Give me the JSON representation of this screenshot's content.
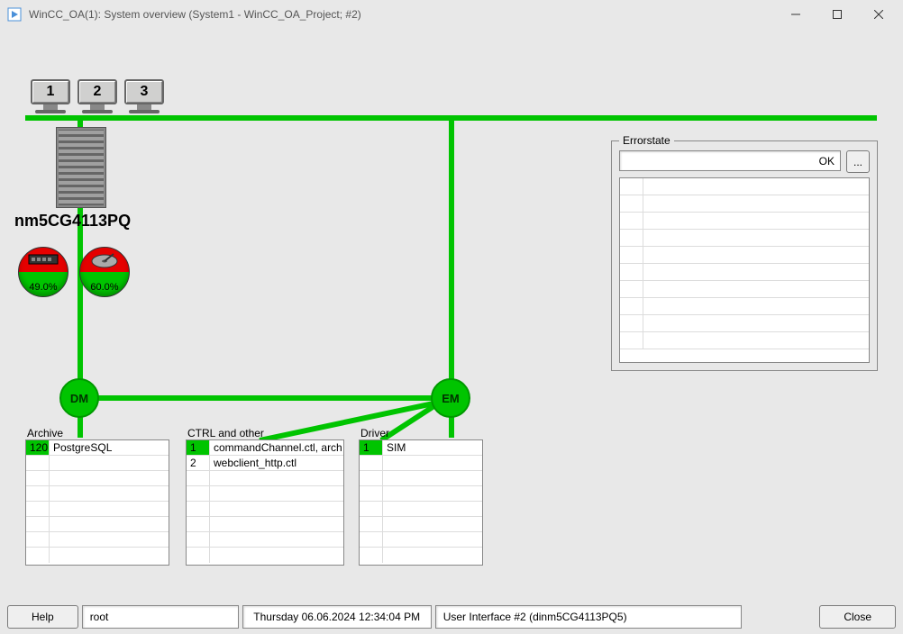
{
  "window": {
    "title": "WinCC_OA(1): System overview (System1 - WinCC_OA_Project; #2)"
  },
  "monitors": [
    "1",
    "2",
    "3"
  ],
  "hostname": "nm5CG4113PQ",
  "gauges": {
    "mem": {
      "label": "49.0%"
    },
    "disk": {
      "label": "60.0%"
    }
  },
  "nodes": {
    "dm": "DM",
    "em": "EM"
  },
  "archive": {
    "title": "Archive",
    "rows": [
      {
        "num": "120",
        "txt": "PostgreSQL",
        "green": true
      }
    ]
  },
  "ctrl": {
    "title": "CTRL and other",
    "rows": [
      {
        "num": "1",
        "txt": "commandChannel.ctl, arch",
        "green": true
      },
      {
        "num": "2",
        "txt": "webclient_http.ctl",
        "green": false
      }
    ]
  },
  "driver": {
    "title": "Driver",
    "rows": [
      {
        "num": "1",
        "txt": "SIM",
        "green": true
      }
    ]
  },
  "errorstate": {
    "legend": "Errorstate",
    "status": "OK",
    "more_btn": "..."
  },
  "footer": {
    "help": "Help",
    "user": "root",
    "datetime": "Thursday 06.06.2024   12:34:04 PM",
    "ui": "User Interface #2 (dinm5CG4113PQ5)",
    "close": "Close"
  }
}
